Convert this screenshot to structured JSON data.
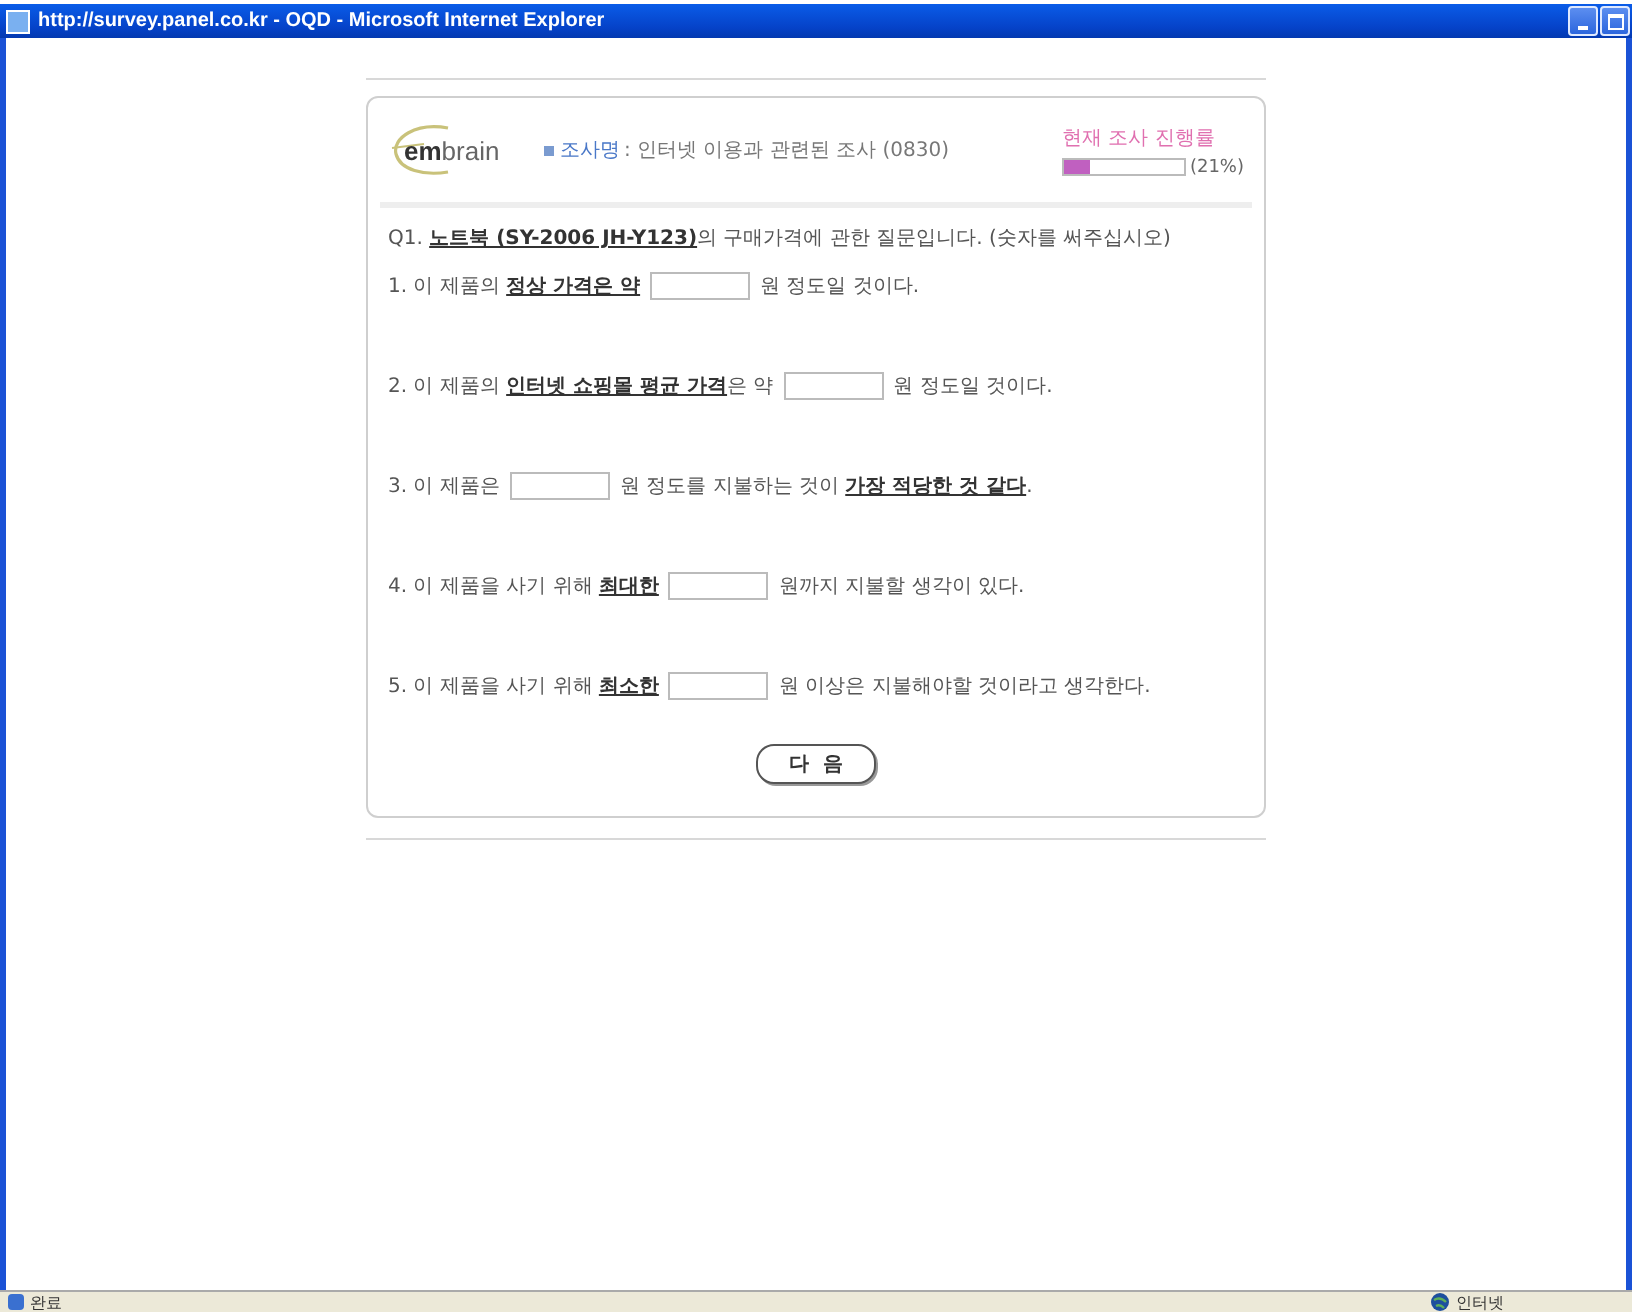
{
  "window": {
    "title": "http://survey.panel.co.kr - OQD - Microsoft Internet Explorer"
  },
  "header": {
    "logo": "**em**brain",
    "survey_label": "조사명",
    "survey_name": ": 인터넷 이용과 관련된 조사 (0830)",
    "progress_label": "현재 조사 진행률",
    "progress": {
      "level": 0.21,
      "reading": "(21%)"
    }
  },
  "intro": [
    {
      "kind": "text",
      "text": "Q1. "
    },
    {
      "kind": "emph",
      "text": "노트북 (SY-2006 JH-Y123)"
    },
    {
      "kind": "text",
      "text": "의 구매가격에 관한 질문입니다. (숫자를 써주십시오)"
    }
  ],
  "questions": [
    [
      {
        "kind": "text",
        "text": "1. 이 제품의 "
      },
      {
        "kind": "emph",
        "text": "정상 가격은 약"
      },
      {
        "kind": "input"
      },
      {
        "kind": "text",
        "text": "원 정도일 것이다."
      }
    ],
    [
      {
        "kind": "text",
        "text": "2. 이 제품의 "
      },
      {
        "kind": "emph",
        "text": "인터넷 쇼핑몰 평균 가격"
      },
      {
        "kind": "text",
        "text": "은 약"
      },
      {
        "kind": "input"
      },
      {
        "kind": "text",
        "text": "원 정도일 것이다."
      }
    ],
    [
      {
        "kind": "text",
        "text": "3. 이 제품은"
      },
      {
        "kind": "input"
      },
      {
        "kind": "text",
        "text": "원 정도를 지불하는 것이 "
      },
      {
        "kind": "emph",
        "text": "가장 적당한 것 같다"
      },
      {
        "kind": "text",
        "text": "."
      }
    ],
    [
      {
        "kind": "text",
        "text": "4. 이 제품을 사기 위해 "
      },
      {
        "kind": "emph",
        "text": "최대한"
      },
      {
        "kind": "input"
      },
      {
        "kind": "text",
        "text": "원까지 지불할 생각이 있다."
      }
    ],
    [
      {
        "kind": "text",
        "text": "5. 이 제품을 사기 위해 "
      },
      {
        "kind": "emph",
        "text": "최소한"
      },
      {
        "kind": "input"
      },
      {
        "kind": "text",
        "text": "원 이상은 지불해야할 것이라고 생각한다."
      }
    ]
  ],
  "next_button": "다  음",
  "status_bar": {
    "left": "완료",
    "right": "인터넷"
  }
}
